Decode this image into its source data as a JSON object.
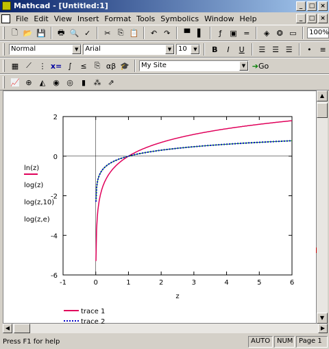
{
  "window": {
    "title": "Mathcad - [Untitled:1]"
  },
  "window_buttons": [
    "_",
    "□",
    "×"
  ],
  "menu": [
    "File",
    "Edit",
    "View",
    "Insert",
    "Format",
    "Tools",
    "Symbolics",
    "Window",
    "Help"
  ],
  "toolbar": {
    "zoom": "100%"
  },
  "format_bar": {
    "style": "Normal",
    "font": "Arial",
    "size": "10",
    "bold": "B",
    "italic": "I",
    "underline": "U"
  },
  "math_bar": {
    "resources": "My Site",
    "go_label": "Go",
    "xeq": "x="
  },
  "chart_data": {
    "type": "line",
    "xlabel": "z",
    "xlim": [
      -1,
      6
    ],
    "ylim": [
      -6,
      2
    ],
    "xticks": [
      "-1",
      "0",
      "1",
      "2",
      "3",
      "4",
      "5",
      "6"
    ],
    "yticks": [
      "2",
      "0",
      "-2",
      "-4",
      "-6"
    ],
    "y_expressions": [
      "ln(z)",
      "log(z)",
      "log(z,10)",
      "log(z,e)"
    ],
    "series": [
      {
        "name": "trace 1",
        "color": "#e0005a",
        "style": "solid",
        "function": "ln"
      },
      {
        "name": "trace 2",
        "color": "#0000c8",
        "style": "dotted",
        "function": "log10"
      }
    ],
    "legend_position": "bottom-left"
  },
  "status": {
    "message": "Press F1 for help",
    "mode": "AUTO",
    "num": "NUM",
    "page": "Page 1"
  }
}
